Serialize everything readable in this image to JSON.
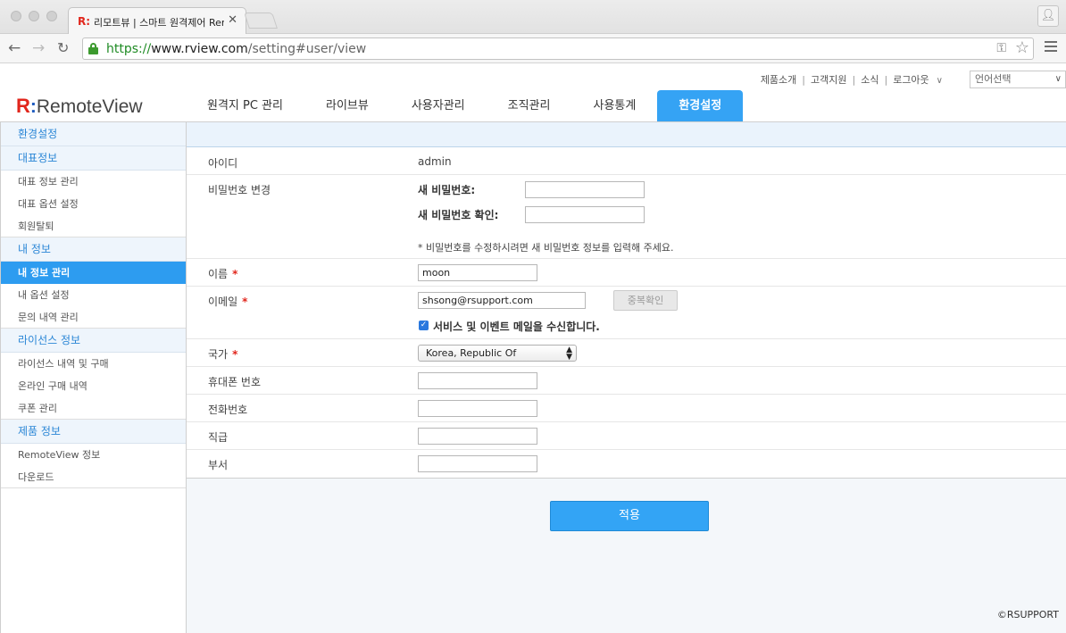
{
  "browser": {
    "tab_title": "리모트뷰 | 스마트 원격제어 RemoteView",
    "tab_favicon": "R:",
    "tab_close": "✕",
    "url_scheme": "https://",
    "url_host": "www.rview.com",
    "url_path": "/setting#user/view",
    "back_icon": "arrow-left-icon",
    "forward_icon": "arrow-right-icon",
    "reload_icon": "reload-icon",
    "profile_icon": "person-icon"
  },
  "header": {
    "logo_r": "R",
    "logo_colon": ":",
    "logo_text": "RemoteView",
    "util_links": [
      "제품소개",
      "고객지원",
      "소식",
      "로그아웃"
    ],
    "language_placeholder": "언어선택",
    "nav": [
      {
        "label": "원격지 PC 관리",
        "active": false
      },
      {
        "label": "라이브뷰",
        "active": false
      },
      {
        "label": "사용자관리",
        "active": false
      },
      {
        "label": "조직관리",
        "active": false
      },
      {
        "label": "사용통계",
        "active": false
      },
      {
        "label": "환경설정",
        "active": true
      }
    ]
  },
  "sidebar": {
    "title": "환경설정",
    "groups": [
      {
        "heading": "대표정보",
        "items": [
          "대표 정보 관리",
          "대표 옵션 설정",
          "회원탈퇴"
        ]
      },
      {
        "heading": "내 정보",
        "items": [
          "내 정보 관리",
          "내 옵션 설정",
          "문의 내역 관리"
        ],
        "active_index": 0
      },
      {
        "heading": "라이선스 정보",
        "items": [
          "라이선스 내역 및 구매",
          "온라인 구매 내역",
          "쿠폰 관리"
        ]
      },
      {
        "heading": "제품 정보",
        "items": [
          "RemoteView 정보",
          "다운로드"
        ]
      }
    ]
  },
  "form": {
    "id_label": "아이디",
    "id_value": "admin",
    "password_label": "비밀번호 변경",
    "new_password_label": "새 비밀번호:",
    "confirm_password_label": "새 비밀번호 확인:",
    "password_note": "* 비밀번호를 수정하시려면 새 비밀번호 정보를 입력해 주세요.",
    "name_label": "이름",
    "name_value": "moon",
    "email_label": "이메일",
    "email_value": "shsong@rsupport.com",
    "duplicate_check_label": "중복확인",
    "email_opt_in_label": "서비스 및 이벤트 메일을 수신합니다.",
    "email_opt_in_checked": true,
    "country_label": "국가",
    "country_value": "Korea, Republic Of",
    "mobile_label": "휴대폰 번호",
    "phone_label": "전화번호",
    "position_label": "직급",
    "department_label": "부서",
    "required_mark": "*",
    "apply_label": "적용"
  },
  "footer": {
    "copyright": "©RSUPPORT"
  },
  "colors": {
    "accent": "#35a3f4",
    "required": "#e1261c",
    "brand_red": "#e1261c",
    "brand_blue": "#1e5bbf"
  }
}
